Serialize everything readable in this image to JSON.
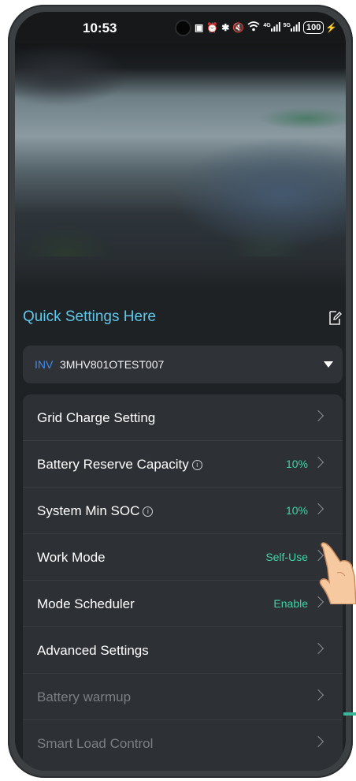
{
  "status_bar": {
    "time": "10:53",
    "icons": [
      "nfc-icon",
      "alarm-icon",
      "bluetooth-icon",
      "mute-icon",
      "wifi-icon",
      "signal-4g-icon",
      "signal-5g-icon"
    ],
    "network_4g": "4G",
    "network_5g": "5G",
    "battery": "100"
  },
  "quick_settings": {
    "title": "Quick Settings Here",
    "edit_icon": "edit-icon"
  },
  "inverter": {
    "tag": "INV",
    "serial": "3MHV801OTEST007"
  },
  "settings": [
    {
      "label": "Grid Charge Setting",
      "value": "",
      "info": false,
      "dim": false
    },
    {
      "label": "Battery Reserve Capacity",
      "value": "10%",
      "info": true,
      "dim": false
    },
    {
      "label": "System Min SOC",
      "value": "10%",
      "info": true,
      "dim": false
    },
    {
      "label": "Work Mode",
      "value": "Self-Use",
      "info": false,
      "dim": false
    },
    {
      "label": "Mode Scheduler",
      "value": "Enable",
      "info": false,
      "dim": false
    },
    {
      "label": "Advanced Settings",
      "value": "",
      "info": false,
      "dim": false
    },
    {
      "label": "Battery warmup",
      "value": "",
      "info": false,
      "dim": true
    },
    {
      "label": "Smart Load Control",
      "value": "",
      "info": false,
      "dim": true
    }
  ],
  "colors": {
    "accent_blue": "#5ec8ec",
    "value_green": "#3fd4a8",
    "inv_tag_blue": "#3d8bf2",
    "background": "#1f2225",
    "card": "#2d3135"
  }
}
